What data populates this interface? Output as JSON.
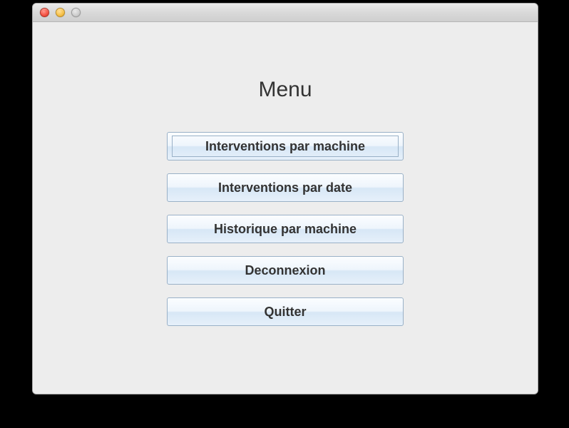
{
  "title": "Menu",
  "buttons": [
    {
      "label": "Interventions par machine",
      "focused": true
    },
    {
      "label": "Interventions par date",
      "focused": false
    },
    {
      "label": "Historique par machine",
      "focused": false
    },
    {
      "label": "Deconnexion",
      "focused": false
    },
    {
      "label": "Quitter",
      "focused": false
    }
  ]
}
